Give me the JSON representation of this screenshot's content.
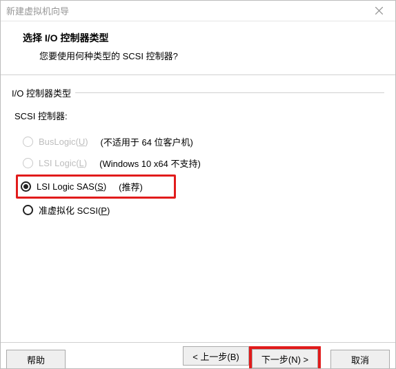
{
  "window": {
    "title": "新建虚拟机向导"
  },
  "header": {
    "title": "选择 I/O 控制器类型",
    "subtitle": "您要使用何种类型的 SCSI 控制器?"
  },
  "group": {
    "legend": "I/O 控制器类型",
    "sublabel": "SCSI 控制器:"
  },
  "options": {
    "buslogic": {
      "label_pre": "BusLogic(",
      "accel": "U",
      "label_post": ")",
      "note": "(不适用于 64 位客户机)"
    },
    "lsilogic": {
      "label_pre": "LSI Logic(",
      "accel": "L",
      "label_post": ")",
      "note": "(Windows 10 x64 不支持)"
    },
    "lsisas": {
      "label_pre": "LSI Logic SAS(",
      "accel": "S",
      "label_post": ")",
      "note": "(推荐)"
    },
    "pvscsi": {
      "label_pre": "准虚拟化 SCSI(",
      "accel": "P",
      "label_post": ")"
    }
  },
  "buttons": {
    "help": "帮助",
    "back": "< 上一步(B)",
    "next": "下一步(N) >",
    "cancel": "取消"
  }
}
